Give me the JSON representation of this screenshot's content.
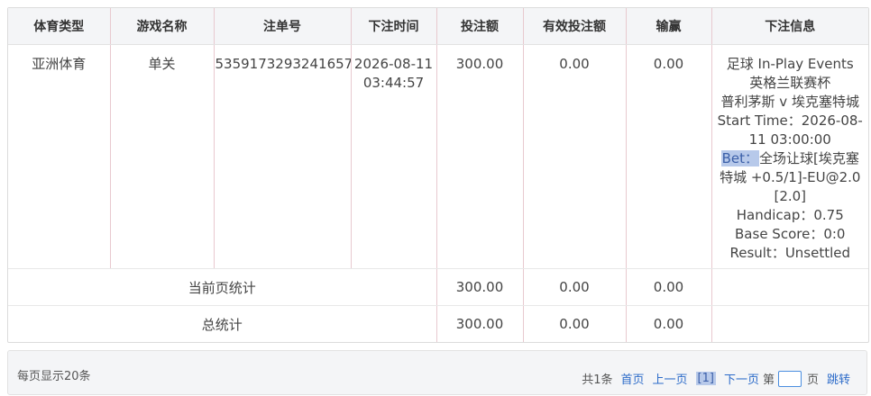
{
  "table": {
    "headers": [
      "体育类型",
      "游戏名称",
      "注单号",
      "下注时间",
      "投注额",
      "有效投注额",
      "输赢",
      "下注信息"
    ],
    "row": {
      "sport_type": "亚洲体育",
      "game_name": "单关",
      "ticket_no": "5359173293241657",
      "bet_time_date": "2026-08-11",
      "bet_time_clock": "03:44:57",
      "stake": "300.00",
      "valid_stake": "0.00",
      "win_loss": "0.00",
      "info": {
        "line1": "足球 In-Play Events",
        "line2": "英格兰联赛杯",
        "line3": "普利茅斯 v 埃克塞特城",
        "line4": "Start Time：2026-08-",
        "line5": "11 03:00:00",
        "line6_prefix": "Bet：",
        "line6_rest": "全场让球[埃克塞",
        "line7": "特城 +0.5/1]-EU@2.0",
        "line8": "[2.0]",
        "line9": "Handicap：0.75",
        "line10": "Base Score：0:0",
        "line11": "Result：Unsettled"
      }
    },
    "page_total": {
      "label": "当前页统计",
      "stake": "300.00",
      "valid_stake": "0.00",
      "win_loss": "0.00"
    },
    "grand_total": {
      "label": "总统计",
      "stake": "300.00",
      "valid_stake": "0.00",
      "win_loss": "0.00"
    }
  },
  "pager": {
    "per_page": "每页显示20条",
    "total": "共1条",
    "first": "首页",
    "prev": "上一页",
    "current": "[1]",
    "next": "下一页",
    "page_prefix": "第",
    "page_input_value": "",
    "page_suffix": "页",
    "go": "跳转"
  },
  "colors": {
    "header_bg": "#f4f5f7",
    "column_divider": "#e8c9cf",
    "link": "#2c6bc9",
    "highlight": "#b7c9ea"
  }
}
